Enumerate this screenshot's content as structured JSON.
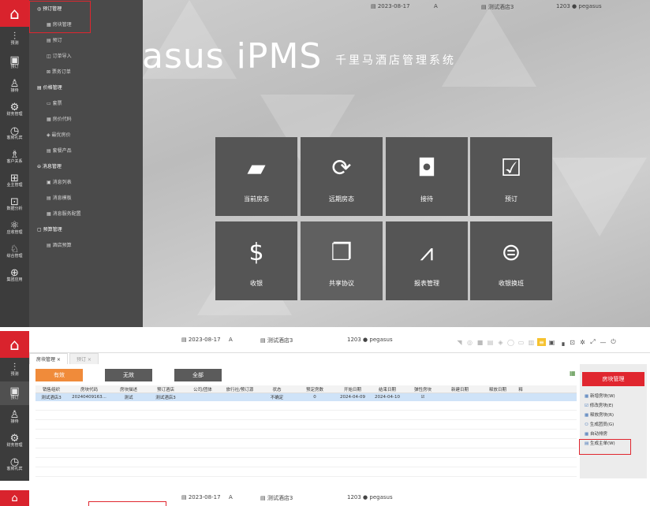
{
  "topbar": {
    "date": "2023-08-17",
    "shift": "A",
    "hotel": "测试酒店3",
    "user_id": "1203",
    "user_name": "pegasus"
  },
  "rail": [
    {
      "icon": "home-icon",
      "glyph": "⌂",
      "label": ""
    },
    {
      "icon": "forecast-icon",
      "glyph": "⫶",
      "label": "预测"
    },
    {
      "icon": "booking-icon",
      "glyph": "▣",
      "label": "预订"
    },
    {
      "icon": "reception-icon",
      "glyph": "♙",
      "label": "接待"
    },
    {
      "icon": "finance-icon",
      "glyph": "⚙",
      "label": "财务管理"
    },
    {
      "icon": "guest-service-icon",
      "glyph": "◷",
      "label": "客房礼宾"
    },
    {
      "icon": "customer-icon",
      "glyph": "♗",
      "label": "客户关系"
    },
    {
      "icon": "business-icon",
      "glyph": "⊞",
      "label": "业主管理"
    },
    {
      "icon": "analysis-icon",
      "glyph": "⊡",
      "label": "数据分析"
    },
    {
      "icon": "ar-icon",
      "glyph": "⚛",
      "label": "应收管理"
    },
    {
      "icon": "admin-icon",
      "glyph": "♘",
      "label": "综合管理"
    },
    {
      "icon": "group-icon",
      "glyph": "⊕",
      "label": "集团应用"
    }
  ],
  "menu": {
    "groups": [
      {
        "label": "◎ 预订管理",
        "items": [
          "▦ 房块管理",
          "▤ 预订",
          "◫ 订单导入",
          "⊠ 票务订单"
        ]
      },
      {
        "label": "▤ 价格管理",
        "items": [
          "▭ 套票",
          "▦ 房价代码",
          "◈ 最优房价",
          "▤ 套餐产品"
        ]
      },
      {
        "label": "⊖ 消息管理",
        "items": [
          "▣ 消息列表",
          "▤ 消息模板",
          "▦ 消息服务配置"
        ]
      },
      {
        "label": "▢ 预算管理",
        "items": [
          "▤ 酒店预算"
        ]
      }
    ]
  },
  "hero": {
    "title": "asus iPMS",
    "subtitle": "千里马酒店管理系统"
  },
  "tiles": [
    {
      "label": "当前房态",
      "icon": "bed-icon",
      "glyph": "▰"
    },
    {
      "label": "远期房态",
      "icon": "forward-rooms-icon",
      "glyph": "⟳"
    },
    {
      "label": "接待",
      "icon": "luggage-icon",
      "glyph": "◘"
    },
    {
      "label": "预订",
      "icon": "calendar-check-icon",
      "glyph": "☑"
    },
    {
      "label": "收银",
      "icon": "cash-icon",
      "glyph": "$"
    },
    {
      "label": "共享协议",
      "icon": "document-icon",
      "glyph": "❐"
    },
    {
      "label": "报表管理",
      "icon": "report-chart-icon",
      "glyph": "⩘"
    },
    {
      "label": "收银换班",
      "icon": "shift-icon",
      "glyph": "⊜"
    }
  ],
  "block_page": {
    "tabs": [
      "房块管理 ×",
      "预订 ×"
    ],
    "filters": [
      {
        "label": "有效",
        "color": "#f08b3a"
      },
      {
        "label": "无效",
        "color": "#5b5b5b"
      },
      {
        "label": "全部",
        "color": "#5b5b5b"
      }
    ],
    "columns": [
      "销售组织",
      "房块代码",
      "房块描述",
      "预订酒店",
      "公司/团体",
      "旅行社/预订源",
      "状态",
      "预定房数",
      "开始日期",
      "结束日期",
      "弹性房块",
      "新建日期",
      "释放日期",
      "释"
    ],
    "rows": [
      [
        "测试酒店3",
        "20240409163...",
        "测试",
        "测试酒店3",
        "",
        "",
        "不确定",
        "0",
        "2024-04-09",
        "2024-04-10",
        "☑",
        "",
        "",
        ""
      ]
    ],
    "side_panel": {
      "title": "房块管理",
      "actions": [
        "新增房块(W)",
        "修改房块(E)",
        "释放房块(R)",
        "生成团员(G)",
        "自动排房",
        "生成主单(W)"
      ]
    }
  },
  "colors": {
    "brand_red": "#d9232d",
    "accent_orange": "#f08b3a",
    "highlight_yellow": "#f6c22e"
  }
}
